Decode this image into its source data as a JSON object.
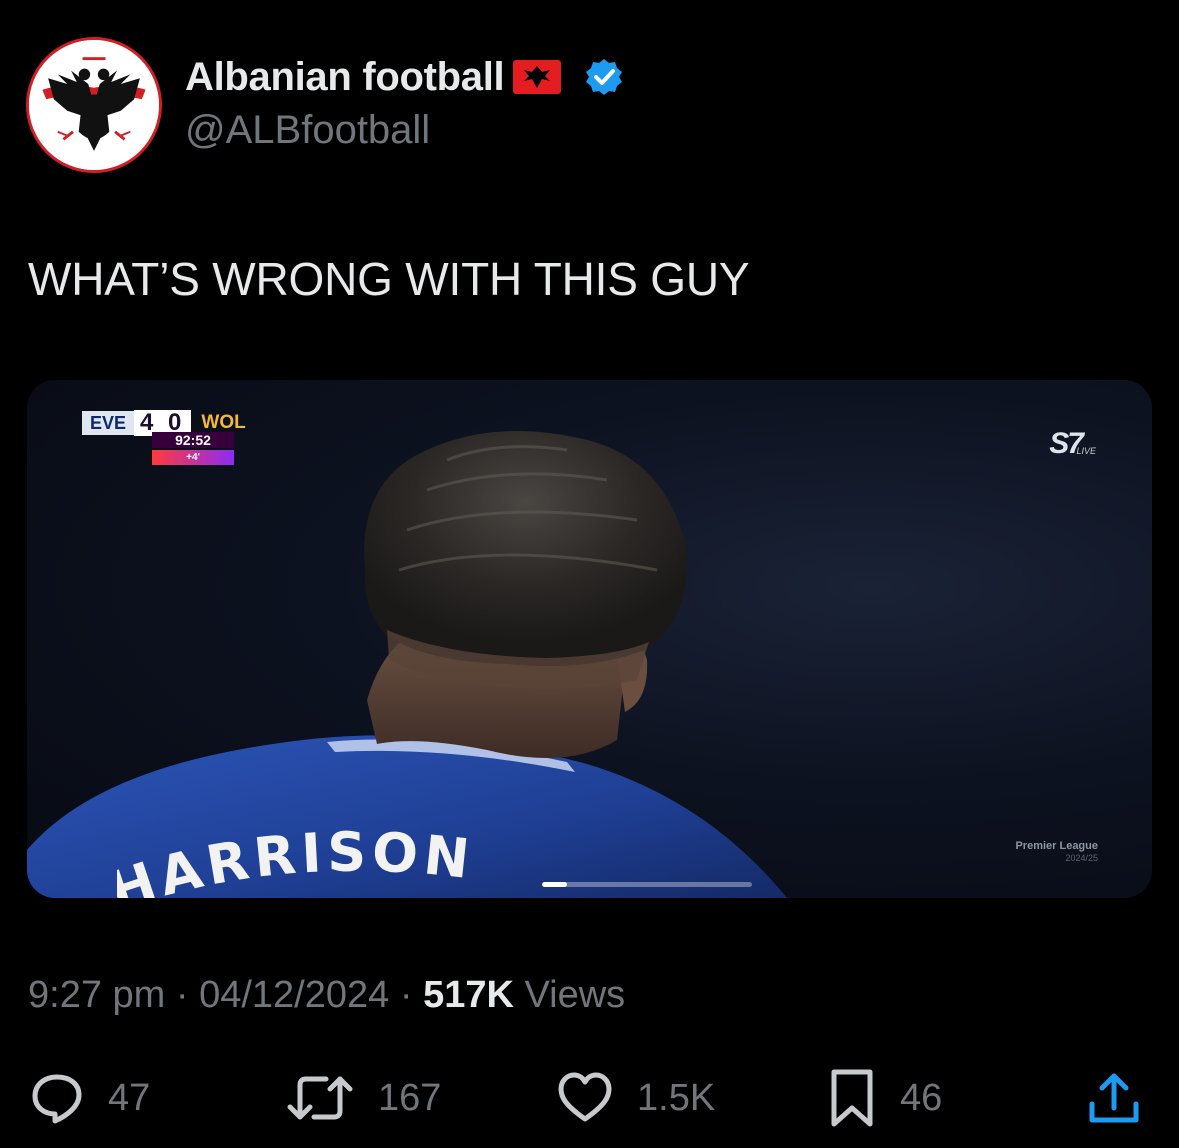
{
  "author": {
    "display_name": "Albanian football",
    "handle": "@ALBfootball",
    "flag_emoji": "albania-flag",
    "verified": true,
    "accent_color": "#1d9bf0",
    "avatar_colors": {
      "border": "#d21f26",
      "eagle": "#111111",
      "band": "#d21f26"
    }
  },
  "tweet": {
    "text": "WHAT’S WRONG WITH THIS GUY"
  },
  "video": {
    "scoreboard": {
      "home_team": "EVE",
      "score": "4 0",
      "away_team": "WOL",
      "clock": "92:52",
      "added_time": "+4'"
    },
    "broadcaster": {
      "logo": "S7",
      "live_label": "LIVE"
    },
    "league": {
      "name": "Premier League",
      "season": "2024/25"
    },
    "shirt_name": "HARRISON",
    "playback_progress": 0.12
  },
  "meta": {
    "time": "9:27 pm",
    "separator": "·",
    "date": "04/12/2024",
    "views_count": "517K",
    "views_label": "Views"
  },
  "actions": {
    "replies": "47",
    "reposts": "167",
    "likes": "1.5K",
    "bookmarks": "46"
  }
}
